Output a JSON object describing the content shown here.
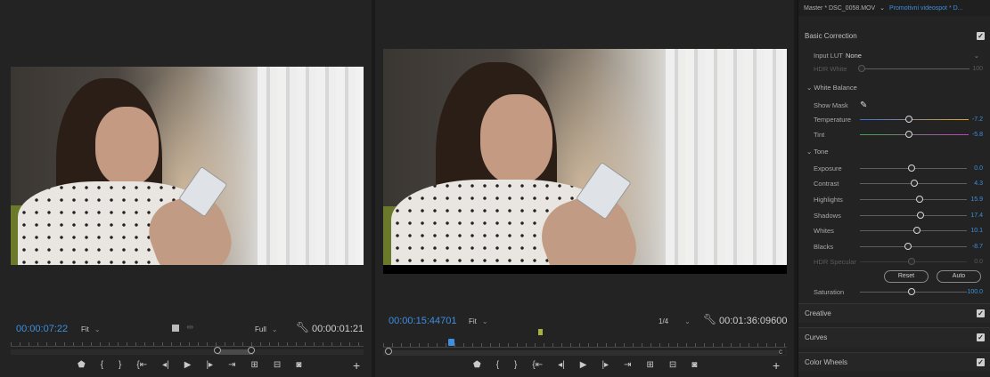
{
  "source_monitor": {
    "timecode": "00:00:07:22",
    "fit": "Fit",
    "resolution": "Full",
    "duration": "00:00:01:21"
  },
  "program_monitor": {
    "timecode": "00:00:15:44701",
    "fit": "Fit",
    "resolution": "1/4",
    "duration": "00:01:36:09600"
  },
  "lumetri": {
    "header": {
      "master": "Master * DSC_0058.MOV",
      "sequence": "Promotivni videospot * D..."
    },
    "basic_correction": {
      "title": "Basic Correction",
      "input_lut_label": "Input LUT",
      "input_lut_value": "None",
      "hdr_white_label": "HDR White",
      "hdr_white_value": "100"
    },
    "white_balance": {
      "title": "White Balance",
      "show_mask": "Show Mask",
      "temperature_label": "Temperature",
      "temperature_value": "-7.2",
      "tint_label": "Tint",
      "tint_value": "-5.8"
    },
    "tone": {
      "title": "Tone",
      "exposure_label": "Exposure",
      "exposure_value": "0.0",
      "contrast_label": "Contrast",
      "contrast_value": "4.3",
      "highlights_label": "Highlights",
      "highlights_value": "15.9",
      "shadows_label": "Shadows",
      "shadows_value": "17.4",
      "whites_label": "Whites",
      "whites_value": "10.1",
      "blacks_label": "Blacks",
      "blacks_value": "-8.7",
      "hdr_specular_label": "HDR Specular",
      "hdr_specular_value": "0.0",
      "reset": "Reset",
      "auto": "Auto",
      "saturation_label": "Saturation",
      "saturation_value": "100.0"
    },
    "sections": {
      "creative": "Creative",
      "curves": "Curves",
      "color_wheels": "Color Wheels"
    },
    "accent_color": "#3d8fe0"
  }
}
